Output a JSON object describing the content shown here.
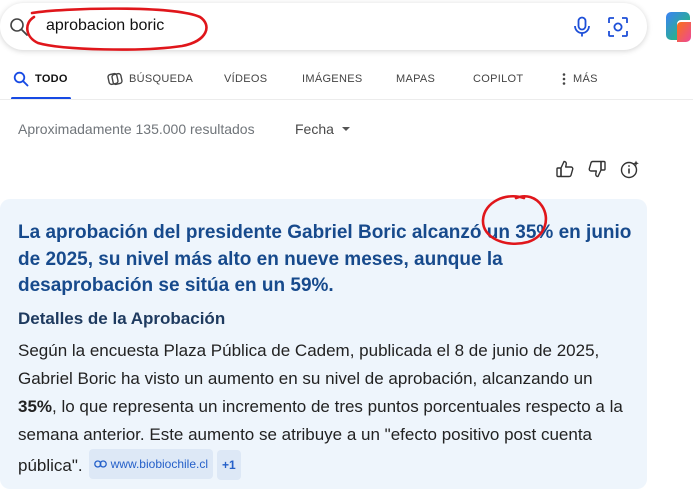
{
  "search": {
    "query": "aprobacion boric",
    "icons": [
      "search-icon",
      "microphone-icon",
      "visual-search-icon",
      "copilot-icon"
    ]
  },
  "tabs": [
    {
      "label": "TODO",
      "icon": "search-icon",
      "active": true
    },
    {
      "label": "BÚSQUEDA",
      "icon": "search-copilot-icon"
    },
    {
      "label": "VÍDEOS"
    },
    {
      "label": "IMÁGENES"
    },
    {
      "label": "MAPAS"
    },
    {
      "label": "COPILOT"
    },
    {
      "label": "MÁS",
      "icon": "more-vertical-icon"
    }
  ],
  "results": {
    "count_text": "Aproximadamente 135.000 resultados",
    "date_filter": "Fecha"
  },
  "feedback_icons": [
    "thumbs-up-icon",
    "thumbs-down-icon",
    "info-icon"
  ],
  "answer": {
    "headline": "La aprobación del presidente Gabriel Boric alcanzó un 35% en junio de 2025, su nivel más alto en nueve meses, aunque la desaprobación se sitúa en un 59%.",
    "section_title": "Detalles de la Aprobación",
    "body_before": "Según la encuesta Plaza Pública de Cadem, publicada el 8 de junio de 2025, Gabriel Boric ha visto un aumento en su nivel de aprobación, alcanzando un ",
    "body_bold": "35%",
    "body_after": ", lo que representa un incremento de tres puntos porcentuales respecto a la semana anterior. Este aumento se atribuye a un \"efecto positivo post cuenta pública\".",
    "citation": "www.biobiochile.cl",
    "citation_more": "+1"
  },
  "colors": {
    "accent": "#174ae4",
    "headline": "#174a8c",
    "card_background": "#eef5fc",
    "annotation_red": "#e0161b"
  }
}
